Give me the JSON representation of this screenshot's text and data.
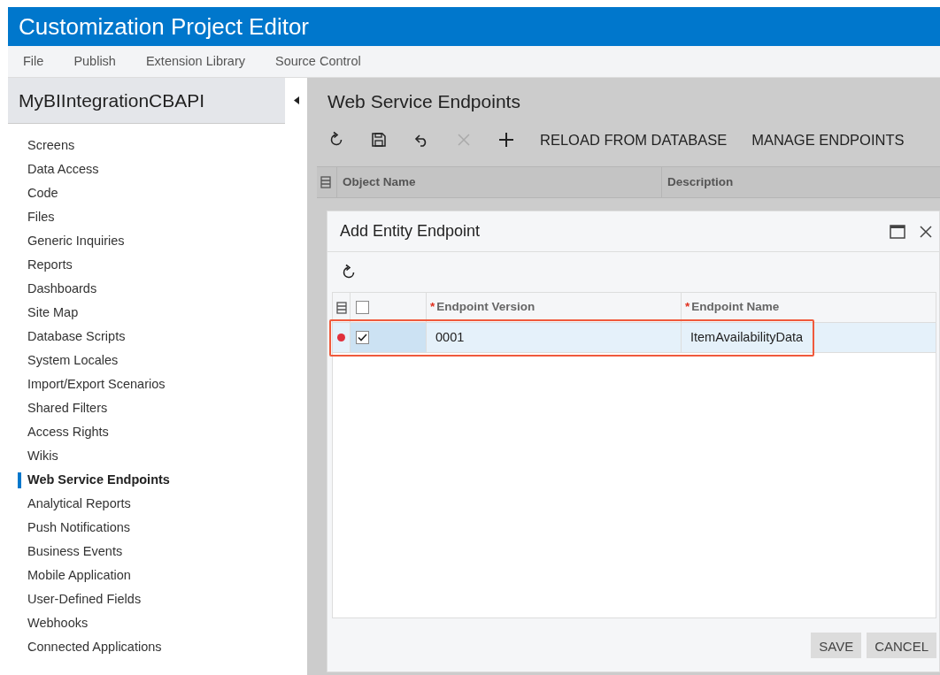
{
  "window": {
    "title": "Customization Project Editor"
  },
  "menu": [
    "File",
    "Publish",
    "Extension Library",
    "Source Control"
  ],
  "sidebar": {
    "project": "MyBIIntegrationCBAPI",
    "items": [
      {
        "label": "Screens",
        "selected": false
      },
      {
        "label": "Data Access",
        "selected": false
      },
      {
        "label": "Code",
        "selected": false
      },
      {
        "label": "Files",
        "selected": false
      },
      {
        "label": "Generic Inquiries",
        "selected": false
      },
      {
        "label": "Reports",
        "selected": false
      },
      {
        "label": "Dashboards",
        "selected": false
      },
      {
        "label": "Site Map",
        "selected": false
      },
      {
        "label": "Database Scripts",
        "selected": false
      },
      {
        "label": "System Locales",
        "selected": false
      },
      {
        "label": "Import/Export Scenarios",
        "selected": false
      },
      {
        "label": "Shared Filters",
        "selected": false
      },
      {
        "label": "Access Rights",
        "selected": false
      },
      {
        "label": "Wikis",
        "selected": false
      },
      {
        "label": "Web Service Endpoints",
        "selected": true
      },
      {
        "label": "Analytical Reports",
        "selected": false
      },
      {
        "label": "Push Notifications",
        "selected": false
      },
      {
        "label": "Business Events",
        "selected": false
      },
      {
        "label": "Mobile Application",
        "selected": false
      },
      {
        "label": "User-Defined Fields",
        "selected": false
      },
      {
        "label": "Webhooks",
        "selected": false
      },
      {
        "label": "Connected Applications",
        "selected": false
      }
    ]
  },
  "page": {
    "title": "Web Service Endpoints",
    "toolbar": [
      {
        "kind": "refresh",
        "disabled": false
      },
      {
        "kind": "save",
        "disabled": false
      },
      {
        "kind": "undo",
        "disabled": false
      },
      {
        "kind": "delete",
        "disabled": true
      },
      {
        "kind": "add",
        "disabled": false
      },
      {
        "kind": "text",
        "label": "RELOAD FROM DATABASE",
        "disabled": false
      },
      {
        "kind": "text",
        "label": "MANAGE ENDPOINTS",
        "disabled": false
      }
    ],
    "columns": [
      "Object Name",
      "Description"
    ]
  },
  "dialog": {
    "title": "Add Entity Endpoint",
    "toolbar": [
      {
        "kind": "refresh",
        "disabled": false
      }
    ],
    "select_all": {
      "checked": false
    },
    "columns": [
      {
        "label": "Endpoint Version",
        "required_mark": "*"
      },
      {
        "label": "Endpoint Name",
        "required_mark": "*"
      }
    ],
    "rows": [
      {
        "modified": true,
        "checked": true,
        "selected": true,
        "outlined": true,
        "cells": [
          "0001",
          "ItemAvailabilityData"
        ]
      }
    ],
    "buttons": [
      "SAVE",
      "CANCEL"
    ]
  }
}
